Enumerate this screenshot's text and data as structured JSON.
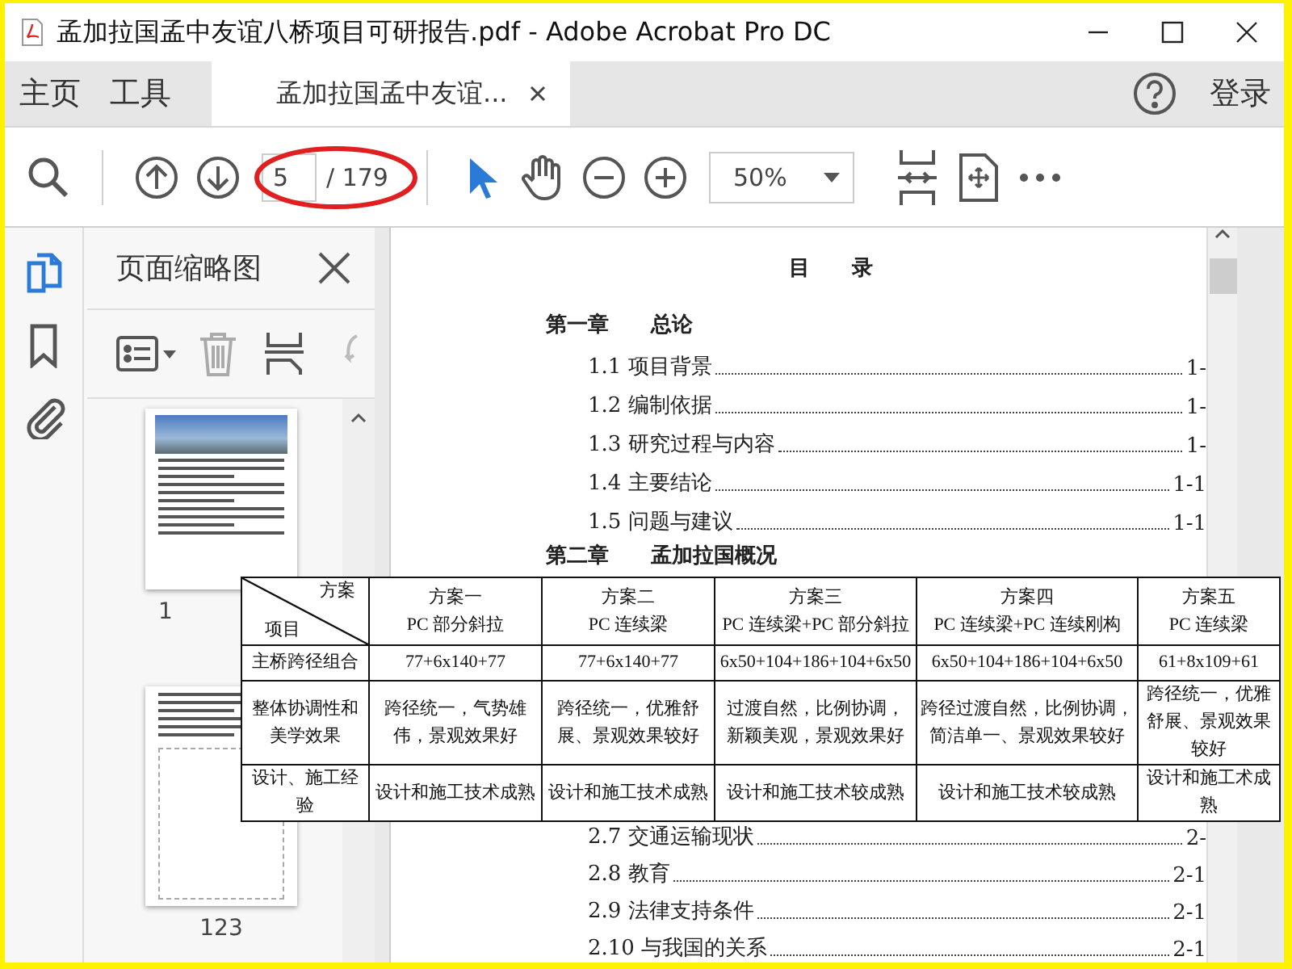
{
  "window": {
    "title": "孟加拉国孟中友谊八桥项目可研报告.pdf - Adobe Acrobat Pro DC"
  },
  "nav_tabs": [
    {
      "label": "主页",
      "kind": "section",
      "selected": false
    },
    {
      "label": "工具",
      "kind": "section",
      "selected": false
    },
    {
      "label": "孟加拉国孟中友谊...",
      "kind": "document",
      "selected": true
    }
  ],
  "account": {
    "login": "登录"
  },
  "toolbar": {
    "page_input": "5",
    "page_total": "/ 179",
    "zoom": "50%"
  },
  "rail": [
    {
      "kind": "pages",
      "selected": true
    },
    {
      "kind": "bookmarks",
      "selected": false
    },
    {
      "kind": "attachments",
      "selected": false
    }
  ],
  "sidebar_panel": {
    "title": "页面缩略图",
    "thumbnails": [
      {
        "label": "1",
        "kind": "photo"
      },
      {
        "label": "123",
        "kind": "drawing"
      }
    ]
  },
  "document": {
    "heading": "目　　录",
    "toc_top": [
      {
        "kind": "chapter",
        "label": "第一章",
        "title": "总论"
      },
      {
        "kind": "entry",
        "title": "1.1 项目背景",
        "page": "1-"
      },
      {
        "kind": "entry",
        "title": "1.2 编制依据",
        "page": "1-"
      },
      {
        "kind": "entry",
        "title": "1.3 研究过程与内容",
        "page": "1-"
      },
      {
        "kind": "entry",
        "title": "1.4 主要结论",
        "page": "1-1"
      },
      {
        "kind": "entry",
        "title": "1.5 问题与建议",
        "page": "1-1"
      },
      {
        "kind": "chapter",
        "label": "第二章",
        "title": "孟加拉国概况"
      }
    ],
    "toc_bottom": [
      {
        "kind": "entry",
        "title": "2.7 交通运输现状",
        "page": "2-"
      },
      {
        "kind": "entry",
        "title": "2.8 教育",
        "page": "2-1"
      },
      {
        "kind": "entry",
        "title": "2.9 法律支持条件",
        "page": "2-1"
      },
      {
        "kind": "entry",
        "title": "2.10 与我国的关系",
        "page": "2-1"
      }
    ]
  },
  "overlay_table": {
    "header_rows": [
      [
        "方案",
        "方案一",
        "方案二",
        "方案三",
        "方案四",
        "方案五"
      ],
      [
        "项目",
        "PC 部分斜拉",
        "PC 连续梁",
        "PC 连续梁+PC 部分斜拉",
        "PC 连续梁+PC 连续刚构",
        "PC 连续梁"
      ]
    ],
    "rows": [
      {
        "label": "主桥跨径组合",
        "cells": [
          "77+6x140+77",
          "77+6x140+77",
          "6x50+104+186+104+6x50",
          "6x50+104+186+104+6x50",
          "61+8x109+61"
        ]
      },
      {
        "label": "整体协调性和美学效果",
        "cells": [
          "跨径统一，气势雄伟，景观效果好",
          "跨径统一，优雅舒展、景观效果较好",
          "过渡自然，比例协调，新颖美观，景观效果好",
          "跨径过渡自然，比例协调，简洁单一、景观效果较好",
          "跨径统一，优雅舒展、景观效果较好"
        ]
      },
      {
        "label": "设计、施工经验",
        "cells": [
          "设计和施工技术成熟",
          "设计和施工技术成熟",
          "设计和施工技术较成熟",
          "设计和施工技术较成熟",
          "设计和施工术成熟"
        ]
      }
    ]
  }
}
